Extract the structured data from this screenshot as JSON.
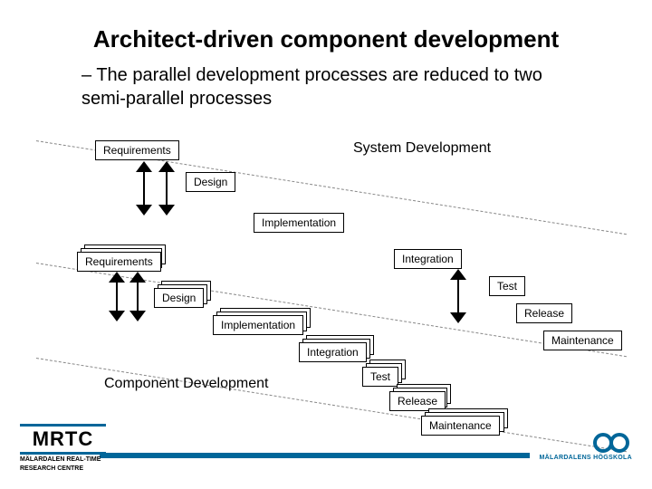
{
  "title": "Architect-driven component development",
  "subtitle": "– The parallel development processes are reduced to two semi-parallel processes",
  "labels": {
    "system_dev": "System Development",
    "component_dev": "Component Development"
  },
  "phases": {
    "requirements": "Requirements",
    "design": "Design",
    "implementation": "Implementation",
    "integration": "Integration",
    "test": "Test",
    "release": "Release",
    "maintenance": "Maintenance"
  },
  "footer": {
    "mrtc": "MRTC",
    "mrtc_sub1": "MÄLARDALEN REAL-TIME",
    "mrtc_sub2": "RESEARCH CENTRE",
    "mdh": "MÄLARDALENS HÖGSKOLA"
  },
  "chart_data": {
    "type": "diagram",
    "title": "Architect-driven component development",
    "description": "Two staggered waterfall-style process tracks (System Development and Component Development) with bidirectional arrows indicating iteration between phases. The parallel development processes are reduced to two semi-parallel processes.",
    "tracks": [
      {
        "name": "System Development",
        "stacked": false,
        "phases": [
          "Requirements",
          "Design",
          "Implementation",
          "Integration",
          "Test",
          "Release",
          "Maintenance"
        ]
      },
      {
        "name": "Component Development",
        "stacked": true,
        "phases": [
          "Requirements",
          "Design",
          "Implementation",
          "Integration",
          "Test",
          "Release",
          "Maintenance"
        ]
      }
    ],
    "bidirectional_arrows": [
      {
        "track": "System Development",
        "between": [
          "Requirements",
          "Design"
        ],
        "span": "to Implementation row"
      },
      {
        "track": "System Development",
        "between": [
          "Integration",
          "Test"
        ],
        "span": "to Release row"
      },
      {
        "track": "Component Development",
        "between": [
          "Requirements",
          "Design"
        ],
        "span": "to Implementation row"
      }
    ],
    "dashed_guides": 3
  }
}
